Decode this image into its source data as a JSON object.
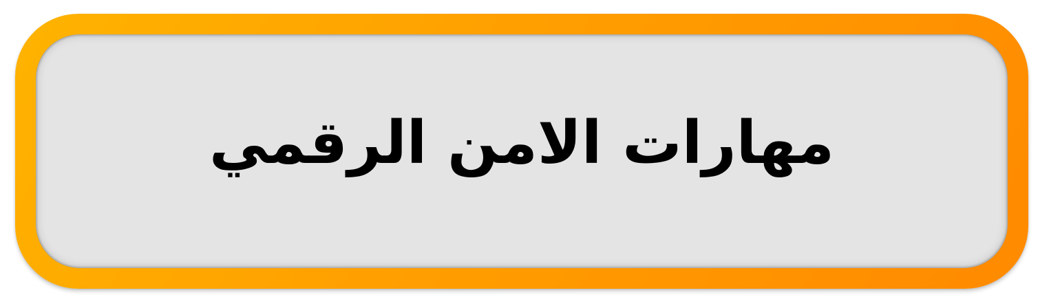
{
  "card": {
    "title": "مهارات الامن الرقمي",
    "colors": {
      "frame_start": "#ffb300",
      "frame_end": "#ff8a00",
      "panel": "#e4e4e4",
      "text": "#000000"
    }
  }
}
